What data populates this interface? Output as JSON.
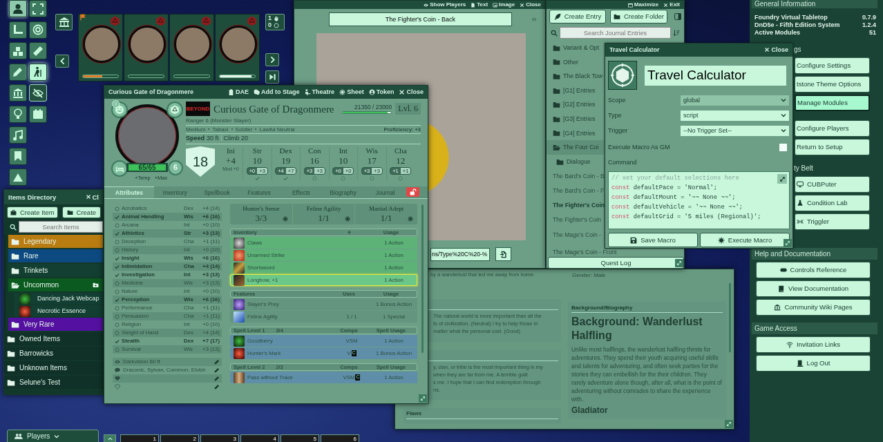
{
  "scene_controls": [
    {
      "selected": true
    },
    {
      "selected": false
    },
    {
      "selected": false
    },
    {
      "selected": false
    },
    {
      "selected": false
    },
    {
      "selected": false
    },
    {
      "selected": false
    },
    {
      "selected": false
    },
    {
      "selected": false
    }
  ],
  "tools": [
    {
      "selected": false,
      "on": false
    },
    {
      "selected": false,
      "on": false
    },
    {
      "selected": false,
      "on": false
    },
    {
      "selected": true,
      "on": false
    },
    {
      "selected": false,
      "on": true
    },
    {
      "selected": false,
      "on": false
    }
  ],
  "party": {
    "members": [
      {
        "level": 0.55
      },
      {
        "level": 0
      },
      {
        "level": 0
      },
      {
        "level": 0.9
      }
    ],
    "counts": [
      "1",
      "0"
    ]
  },
  "character_sheet": {
    "title": "Curious Gate of Dragonmere",
    "header_buttons": [
      "DAE",
      "Add to Stage",
      "Theatre",
      "Sheet",
      "Token",
      "Close"
    ],
    "effects_count": "0",
    "hp": {
      "value": "65/65",
      "level": 1
    },
    "hit_dice": "6",
    "hp_links": [
      "+Temp",
      "+Max"
    ],
    "logo": "BEYOND",
    "name": "Curious Gate of Dragonmere",
    "xp": {
      "value": "21350 / 23000",
      "level": 0.93
    },
    "level_label": "Lvl. 6",
    "class_line": "Ranger 6 (Monster Slayer)",
    "details": [
      "Medium",
      "Tabaxi",
      "Soldier",
      "Lawful Neutral"
    ],
    "proficiency": "Proficiency: +3",
    "speed_label": "Speed",
    "speed": "30 ft",
    "speed_extra": "Climb 20",
    "ac": "18",
    "initiative": {
      "label": "Ini",
      "value": "+4",
      "mod": "Mod +0"
    },
    "abilities": [
      {
        "label": "Str",
        "score": "10",
        "mod": "+0",
        "save": "+3",
        "proficient": true
      },
      {
        "label": "Dex",
        "score": "19",
        "mod": "+4",
        "save": "+7",
        "proficient": true
      },
      {
        "label": "Con",
        "score": "16",
        "mod": "+3",
        "save": "+3",
        "proficient": false
      },
      {
        "label": "Int",
        "score": "10",
        "mod": "+0",
        "save": "+0",
        "proficient": false
      },
      {
        "label": "Wis",
        "score": "17",
        "mod": "+3",
        "save": "+3",
        "proficient": false
      },
      {
        "label": "Cha",
        "score": "12",
        "mod": "+1",
        "save": "+1",
        "proficient": false
      }
    ],
    "tabs": [
      {
        "label": "Attributes",
        "selected": true
      },
      {
        "label": "Inventory",
        "selected": false
      },
      {
        "label": "Spellbook",
        "selected": false
      },
      {
        "label": "Features",
        "selected": false
      },
      {
        "label": "Effects",
        "selected": false
      },
      {
        "label": "Biography",
        "selected": false
      },
      {
        "label": "Journal",
        "selected": false
      }
    ],
    "skills": [
      {
        "name": "Acrobatics",
        "ability": "Dex",
        "value": "+4 (14)",
        "proficient": false
      },
      {
        "name": "Animal Handling",
        "ability": "Wis",
        "value": "+6 (16)",
        "proficient": true
      },
      {
        "name": "Arcana",
        "ability": "Int",
        "value": "+0 (10)",
        "proficient": false
      },
      {
        "name": "Athletics",
        "ability": "Str",
        "value": "+3 (13)",
        "proficient": true
      },
      {
        "name": "Deception",
        "ability": "Cha",
        "value": "+1 (11)",
        "proficient": false
      },
      {
        "name": "History",
        "ability": "Int",
        "value": "+0 (10)",
        "proficient": false
      },
      {
        "name": "Insight",
        "ability": "Wis",
        "value": "+6 (16)",
        "proficient": true
      },
      {
        "name": "Intimidation",
        "ability": "Cha",
        "value": "+4 (14)",
        "proficient": true
      },
      {
        "name": "Investigation",
        "ability": "Int",
        "value": "+3 (13)",
        "proficient": true
      },
      {
        "name": "Medicine",
        "ability": "Wis",
        "value": "+3 (13)",
        "proficient": false
      },
      {
        "name": "Nature",
        "ability": "Int",
        "value": "+0 (10)",
        "proficient": false
      },
      {
        "name": "Perception",
        "ability": "Wis",
        "value": "+6 (16)",
        "proficient": true
      },
      {
        "name": "Performance",
        "ability": "Cha",
        "value": "+1 (11)",
        "proficient": false
      },
      {
        "name": "Persuasion",
        "ability": "Cha",
        "value": "+1 (11)",
        "proficient": false
      },
      {
        "name": "Religion",
        "ability": "Int",
        "value": "+0 (10)",
        "proficient": false
      },
      {
        "name": "Sleight of Hand",
        "ability": "Dex",
        "value": "+4 (14)",
        "proficient": false
      },
      {
        "name": "Stealth",
        "ability": "Dex",
        "value": "+7 (17)",
        "proficient": true
      },
      {
        "name": "Survival",
        "ability": "Wis",
        "value": "+3 (13)",
        "proficient": false
      }
    ],
    "traits": [
      {
        "kind": "senses",
        "text": "Darkvision 60 ft"
      },
      {
        "kind": "languages",
        "text": "Draconic, Sylvan, Common, Elvish"
      },
      {
        "kind": "resistances"
      },
      {
        "kind": "immunities"
      }
    ],
    "resources": [
      {
        "name": "Hunter's Sense",
        "value": "3/3"
      },
      {
        "name": "Feline Agility",
        "value": "1/1"
      },
      {
        "name": "Martial Adept",
        "value": "1/1"
      }
    ],
    "inventory": {
      "title": "Inventory",
      "usage_label": "Usage",
      "items": [
        {
          "name": "Claws",
          "usage": "1 Action",
          "selected": false
        },
        {
          "name": "Unarmed Strike",
          "usage": "1 Action",
          "selected": false
        },
        {
          "name": "Shortsword",
          "usage": "1 Action",
          "selected": false
        },
        {
          "name": "Longbow, +1",
          "usage": "1 Action",
          "selected": true
        }
      ]
    },
    "features": {
      "title": "Features",
      "uses_label": "Uses",
      "usage_label": "Usage",
      "items": [
        {
          "name": "Slayer's Prey",
          "usage": "1 Bonus Action"
        },
        {
          "name": "Feline Agility",
          "uses": "1 / 1",
          "usage": "1 Special"
        }
      ]
    },
    "spell_levels": [
      {
        "title": "Spell Level 1",
        "slots": "3/4",
        "comps_label": "Comps",
        "usage_label": "Spell Usage",
        "spells": [
          {
            "name": "Goodberry",
            "comps": "VSM",
            "usage": "1 Action"
          },
          {
            "name": "Hunter's Mark",
            "comps": "V",
            "concentration_mark": "C",
            "usage": "1 Bonus Action"
          }
        ]
      },
      {
        "title": "Spell Level 2",
        "slots": "2/2",
        "comps_label": "Comps",
        "usage_label": "Spell Usage",
        "spells": [
          {
            "name": "Pass without Trace",
            "comps": "VSM",
            "concentration_mark": "C",
            "usage": "1 Action"
          }
        ]
      }
    ]
  },
  "items_directory": {
    "title": "Items Directory",
    "close": "Cl",
    "buttons": [
      "Create Item",
      "Create"
    ],
    "search_placeholder": "Search Items",
    "folders": [
      {
        "expanded": true,
        "children": [
          {
            "name": "Legendary",
            "color": "#b97c10",
            "expanded": false
          },
          {
            "name": "Rare",
            "color": "#0e4a82",
            "expanded": false
          },
          {
            "name": "Trinkets",
            "color": "#123f31",
            "expanded": false
          },
          {
            "name": "Uncommon",
            "color": "#0b5a1f",
            "expanded": true,
            "children": [
              {
                "name": "Dancing Jack Webcap"
              },
              {
                "name": "Necrotic Essence"
              }
            ]
          },
          {
            "name": "Very Rare",
            "color": "#5410a0",
            "expanded": false
          }
        ]
      },
      {
        "name": "Owned Items",
        "color": "#0f3127",
        "expanded": false
      },
      {
        "name": "Barrowicks",
        "color": "#0f3127",
        "expanded": false
      },
      {
        "name": "Unknown Items",
        "color": "#0f3127",
        "expanded": false
      },
      {
        "name": "Selune's Test",
        "color": "#0f3127",
        "expanded": false
      }
    ]
  },
  "players_button": "Players",
  "hotbar": {
    "slots": [
      "1",
      "2",
      "3",
      "4",
      "5",
      "6"
    ]
  },
  "image_popout": {
    "header_buttons": [
      "Show Players",
      "Text",
      "Image",
      "Close"
    ],
    "title": "The Fighter's Coin - Back",
    "url": "ns/Type%20C%20-%"
  },
  "journal_directory": {
    "header_buttons": [
      "Maximize",
      "Exit"
    ],
    "buttons": [
      "Create Entry",
      "Create Folder"
    ],
    "search_placeholder": "Search Journal Entries",
    "entries": [
      {
        "kind": "folder",
        "name": "Variant & Opt",
        "expanded": false
      },
      {
        "kind": "folder",
        "name": "Other",
        "expanded": false
      },
      {
        "kind": "folder",
        "name": "The Black Tow",
        "expanded": false
      },
      {
        "kind": "folder",
        "name": "[G1] Entries",
        "expanded": false
      },
      {
        "kind": "folder",
        "name": "[G2] Entries",
        "expanded": false
      },
      {
        "kind": "folder",
        "name": "[G3] Entries",
        "expanded": false
      },
      {
        "kind": "folder",
        "name": "[G4] Entries",
        "expanded": false
      },
      {
        "kind": "folder",
        "name": "The Four Coi",
        "expanded": true,
        "children": [
          {
            "kind": "folder",
            "name": "Dialogue",
            "expanded": false
          },
          {
            "kind": "entry",
            "name": "The Bard's Coin - B",
            "selected": false
          },
          {
            "kind": "entry",
            "name": "The Bard's Coin - F",
            "selected": false
          },
          {
            "kind": "entry",
            "name": "The Fighter's Coin",
            "selected": true
          },
          {
            "kind": "entry",
            "name": "The Fighter's Coin",
            "selected": false
          },
          {
            "kind": "entry",
            "name": "The Mage's Coin -",
            "selected": false
          },
          {
            "kind": "entry",
            "name": "The Mage's Coin - Front",
            "selected": false
          }
        ]
      }
    ],
    "quest_log": "Quest Log"
  },
  "macro_config": {
    "title": "Travel Calculator",
    "close": "Close",
    "name": "Travel Calculator",
    "fields": [
      {
        "label": "Scope",
        "value": "global",
        "disabled": true
      },
      {
        "label": "Type",
        "value": "script",
        "disabled": false
      },
      {
        "label": "Trigger",
        "value": "--No Trigger Set--",
        "disabled": false
      }
    ],
    "gm_label": "Execute Macro As GM",
    "gm_checked": false,
    "command_label": "Command",
    "code": [
      {
        "kind": "comment",
        "text": "// set your default selections here"
      },
      {
        "kind": "statement",
        "keyword": "const",
        "text": "defaultPace = 'Normal';"
      },
      {
        "kind": "statement",
        "keyword": "const",
        "text": "defaultMount = '~~ None ~~';"
      },
      {
        "kind": "statement",
        "keyword": "const",
        "text": "defaultVehicle = '~~ None ~~';"
      },
      {
        "kind": "statement",
        "keyword": "const",
        "text": "defaultGrid = '5 miles (Regional)';"
      }
    ],
    "buttons": [
      "Save Macro",
      "Execute Macro"
    ]
  },
  "settings_sidebar": {
    "sections": [
      {
        "title": "General Information",
        "info": [
          {
            "label": "Foundry Virtual Tabletop",
            "value": "0.7.9"
          },
          {
            "label": "DnD5e - Fifth Edition System",
            "value": "1.2.4"
          },
          {
            "label": "Active Modules",
            "value": "51"
          }
        ]
      },
      {
        "title": "gs",
        "buttons": [
          {
            "label": "Configure Settings",
            "selected": false
          },
          {
            "label": "tstone Theme Options",
            "selected": false
          },
          {
            "label": "Manage Modules",
            "selected": true
          },
          {
            "label": "Configure Players",
            "selected": false
          },
          {
            "label": "Return to Setup",
            "selected": false
          }
        ]
      },
      {
        "title": "ty Belt",
        "buttons": [
          {
            "label": "CUBPuter",
            "selected": false
          },
          {
            "label": "Condition Lab",
            "selected": false
          },
          {
            "label": "Triggler",
            "selected": false
          }
        ]
      },
      {
        "title": "Help and Documentation",
        "buttons": [
          {
            "label": "Controls Reference",
            "selected": false
          },
          {
            "label": "View Documentation",
            "selected": false
          },
          {
            "label": "Community Wiki Pages",
            "selected": false
          }
        ]
      },
      {
        "title": "Game Access",
        "buttons": [
          {
            "label": "Invitation Links",
            "selected": false
          },
          {
            "label": "Log Out",
            "selected": false
          }
        ]
      }
    ]
  },
  "biography_sheet": {
    "top_line": "by a wanderlust that led me away from home.",
    "gender": "Gender: Male",
    "cards": [
      {
        "lines": [
          "The natural world is more important than all the",
          "ts of civilization. (Neutral) I try to help those in",
          "matter what the personal cost. (Good)"
        ]
      },
      {
        "lines": [
          "y, clan, or tribe is the most important thing in my",
          "when they are far from me. A terrible guilt",
          "s me. I hope that I can find redemption through",
          "ns."
        ]
      },
      {
        "title": "Flaws"
      }
    ],
    "biography": {
      "title": "Background/Biography",
      "heading": "Background: Wanderlust Halfling",
      "paragraph": "Unlike most halflings, the wanderlust halfling thirsts for adventures. They spend their youth acquiring useful skills and talents for adventuring, and often seek parties for the stories they can embellish for the their children. They rarely adventure alone though, after all, what is the point of adventuring without comrades to share the experience with.",
      "subheading": "Gladiator"
    }
  }
}
